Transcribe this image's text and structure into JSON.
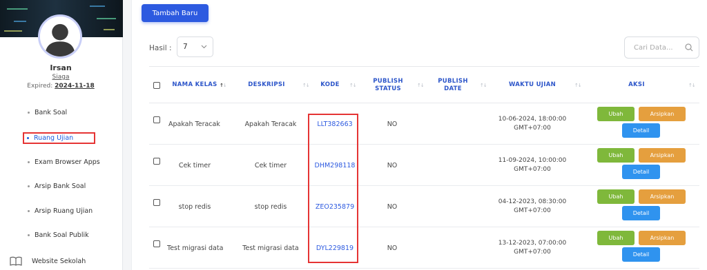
{
  "colors": {
    "primary": "#2d5ae0",
    "highlight": "#e53333",
    "ubah": "#7fb83b",
    "arsip": "#e59f3e",
    "detail": "#2f93ef"
  },
  "user": {
    "name": "Irsan",
    "level": "Siaga",
    "expired_label": "Expired:",
    "expired_date": "2024-11-18"
  },
  "sidebar": {
    "items": [
      {
        "label": "Bank Soal",
        "active": false
      },
      {
        "label": "Ruang Ujian",
        "active": true
      },
      {
        "label": "Exam Browser Apps",
        "active": false
      },
      {
        "label": "Arsip Bank Soal",
        "active": false
      },
      {
        "label": "Arsip Ruang Ujian",
        "active": false
      },
      {
        "label": "Bank Soal Publik",
        "active": false
      }
    ],
    "website": {
      "label": "Website Sekolah",
      "icon": "book-icon"
    }
  },
  "toolbar": {
    "add_label": "Tambah Baru",
    "hasil_label": "Hasil :",
    "hasil_value": "7",
    "search_placeholder": "Cari Data..."
  },
  "table": {
    "headers": {
      "nama": "NAMA KELAS",
      "deskripsi": "DESKRIPSI",
      "kode": "KODE",
      "publish_status": "PUBLISH\nSTATUS",
      "publish_date": "PUBLISH\nDATE",
      "waktu": "WAKTU UJIAN",
      "aksi": "AKSI"
    },
    "actions": {
      "ubah": "Ubah",
      "arsip": "Arsipkan",
      "detail": "Detail"
    },
    "rows": [
      {
        "nama": "Apakah Teracak",
        "deskripsi": "Apakah Teracak",
        "kode": "LLT382663",
        "status": "NO",
        "date": "",
        "waktu": "10-06-2024, 18:00:00\nGMT+07:00"
      },
      {
        "nama": "Cek timer",
        "deskripsi": "Cek timer",
        "kode": "DHM298118",
        "status": "NO",
        "date": "",
        "waktu": "11-09-2024, 10:00:00\nGMT+07:00"
      },
      {
        "nama": "stop redis",
        "deskripsi": "stop redis",
        "kode": "ZEO235879",
        "status": "NO",
        "date": "",
        "waktu": "04-12-2023, 08:30:00\nGMT+07:00"
      },
      {
        "nama": "Test migrasi data",
        "deskripsi": "Test migrasi data",
        "kode": "DYL229819",
        "status": "NO",
        "date": "",
        "waktu": "13-12-2023, 07:00:00\nGMT+07:00"
      }
    ]
  }
}
